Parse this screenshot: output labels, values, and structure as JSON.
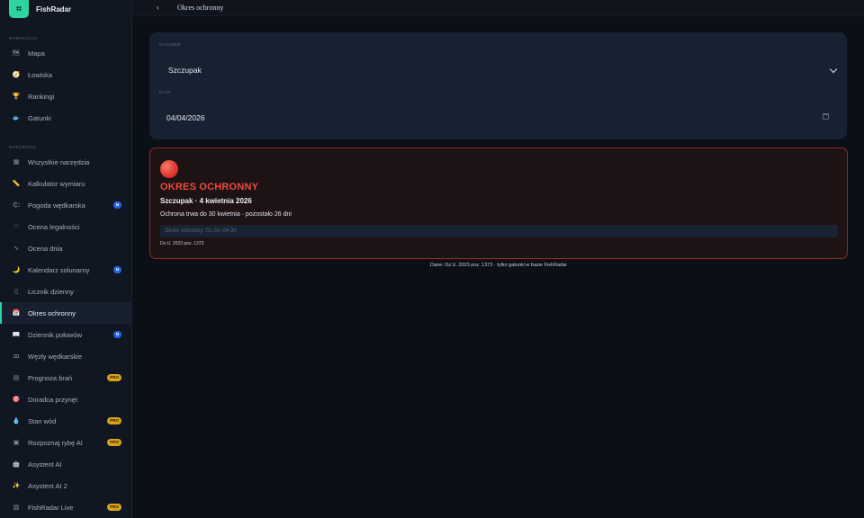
{
  "app": {
    "name": "FishRadar",
    "logo_glyph": "⌗"
  },
  "sidebar": {
    "section_nav": "NAWIGACJA",
    "nav": [
      {
        "label": "Mapa",
        "icon": "map-icon",
        "glyph": "🗺"
      },
      {
        "label": "Łowiska",
        "icon": "compass-icon",
        "glyph": "🧭"
      },
      {
        "label": "Rankingi",
        "icon": "trophy-icon",
        "glyph": "🏆"
      },
      {
        "label": "Gatunki",
        "icon": "fish-icon",
        "glyph": "🐟"
      }
    ],
    "section_tools": "NARZĘDZIA",
    "tools": [
      {
        "label": "Wszystkie narzędzia",
        "icon": "toolbox-icon",
        "glyph": "▦",
        "badge": ""
      },
      {
        "label": "Kalkulator wymiaru",
        "icon": "ruler-icon",
        "glyph": "📏",
        "badge": ""
      },
      {
        "label": "Pogoda wędkarska",
        "icon": "weather-icon",
        "glyph": "🌤",
        "badge": "N"
      },
      {
        "label": "Ocena legalności",
        "icon": "shield-icon",
        "glyph": "♡",
        "badge": ""
      },
      {
        "label": "Ocena dnia",
        "icon": "chart-icon",
        "glyph": "∿",
        "badge": ""
      },
      {
        "label": "Kalendarz solunarny",
        "icon": "moon-icon",
        "glyph": "🌙",
        "badge": "N"
      },
      {
        "label": "Licznik dzienny",
        "icon": "counter-icon",
        "glyph": "▯",
        "badge": ""
      },
      {
        "label": "Okres ochronny",
        "icon": "calendar-icon",
        "glyph": "📅",
        "badge": ""
      },
      {
        "label": "Dziennik połowów",
        "icon": "book-icon",
        "glyph": "📖",
        "badge": "N"
      },
      {
        "label": "Węzły wędkarskie",
        "icon": "knot-icon",
        "glyph": "ꝏ",
        "badge": ""
      },
      {
        "label": "Prognoza brań",
        "icon": "forecast-icon",
        "glyph": "▤",
        "badge": "PRO"
      },
      {
        "label": "Doradca przynęt",
        "icon": "bait-icon",
        "glyph": "🎯",
        "badge": ""
      },
      {
        "label": "Stan wód",
        "icon": "water-drop-icon",
        "glyph": "💧",
        "badge": "PRO"
      },
      {
        "label": "Rozpoznaj rybę AI",
        "icon": "scan-icon",
        "glyph": "▣",
        "badge": "PRO"
      },
      {
        "label": "Asystent AI",
        "icon": "robot-icon",
        "glyph": "🤖",
        "badge": ""
      },
      {
        "label": "Asystent AI 2",
        "icon": "sparkle-icon",
        "glyph": "✨",
        "badge": ""
      },
      {
        "label": "FishRadar Live",
        "icon": "live-icon",
        "glyph": "▧",
        "badge": "PRO"
      }
    ],
    "active_label": "Okres ochronny"
  },
  "topbar": {
    "back_glyph": "‹",
    "title": "Okres ochronny"
  },
  "form": {
    "species_label": "GATUNEK",
    "species_value": "Szczupak",
    "date_label": "DATA",
    "date_value": "04/04/2026"
  },
  "result": {
    "status": "OKRES OCHRONNY",
    "summary": "Szczupak · 4 kwietnia 2026",
    "detail": "Ochrona trwa do 30 kwietnia · pozostało 26 dni",
    "period": "Okres ochronny: 01-01–04-30",
    "source": "Dz.U. 2023 poz. 1373",
    "status_color": "#ef4a3f"
  },
  "footnote": "Dane: Dz.U. 2023 poz. 1373 · tylko gatunki w bazie FishRadar",
  "colors": {
    "accent": "#2dd4a0",
    "danger": "#ef4a3f",
    "badge_new": "#2563eb",
    "badge_pro": "#d9a21b"
  }
}
